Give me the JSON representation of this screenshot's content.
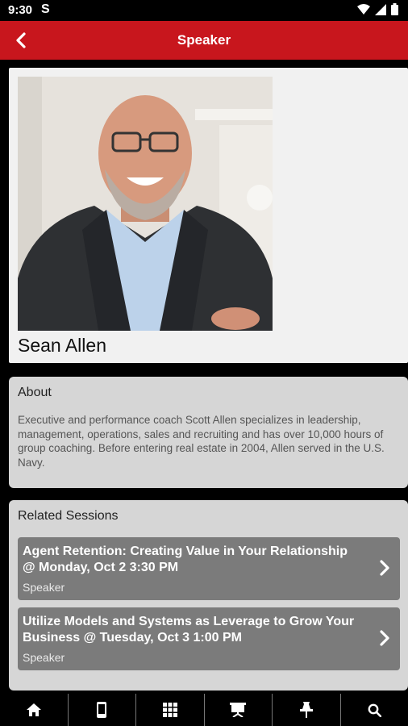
{
  "status_bar": {
    "time": "9:30",
    "notification_icon": "S"
  },
  "app_bar": {
    "title": "Speaker"
  },
  "speaker": {
    "name": "Sean Allen"
  },
  "about": {
    "heading": "About",
    "text": "Executive and performance coach Scott Allen specializes in leadership, management, operations, sales and recruiting and has over 10,000 hours of group coaching. Before entering real estate in 2004, Allen served in the U.S. Navy."
  },
  "related": {
    "heading": "Related Sessions",
    "sessions": [
      {
        "title": "Agent Retention: Creating Value in Your Relationship @ Monday, Oct 2 3:30 PM",
        "role": "Speaker"
      },
      {
        "title": "Utilize Models and Systems as Leverage to Grow Your Business @ Tuesday, Oct 3 1:00 PM",
        "role": "Speaker"
      }
    ]
  },
  "tab_bar": {
    "tabs": [
      "home-icon",
      "phone-icon",
      "grid-icon",
      "presentation-icon",
      "pin-icon",
      "search-icon"
    ]
  },
  "colors": {
    "primary": "#c8161d",
    "session_bg": "#7b7b7b",
    "card_bg": "#d6d6d6"
  }
}
